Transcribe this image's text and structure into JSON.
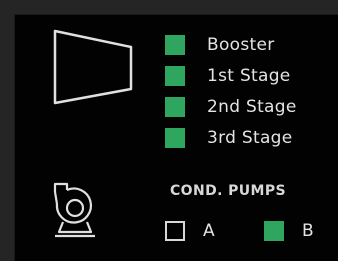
{
  "compressor": {
    "icon": "compressor-icon",
    "stages": [
      {
        "label": "Booster",
        "state": "on"
      },
      {
        "label": "1st Stage",
        "state": "on"
      },
      {
        "label": "2nd Stage",
        "state": "on"
      },
      {
        "label": "3rd Stage",
        "state": "on"
      }
    ]
  },
  "cond_pumps": {
    "icon": "pump-icon",
    "title": "COND. PUMPS",
    "pumps": [
      {
        "label": "A",
        "state": "off"
      },
      {
        "label": "B",
        "state": "on"
      }
    ]
  },
  "colors": {
    "active": "#2fa660",
    "inactive_outline": "#d8d8d8",
    "panel_background": "#020202",
    "page_background": "#252525",
    "text": "#e4e4e4"
  }
}
